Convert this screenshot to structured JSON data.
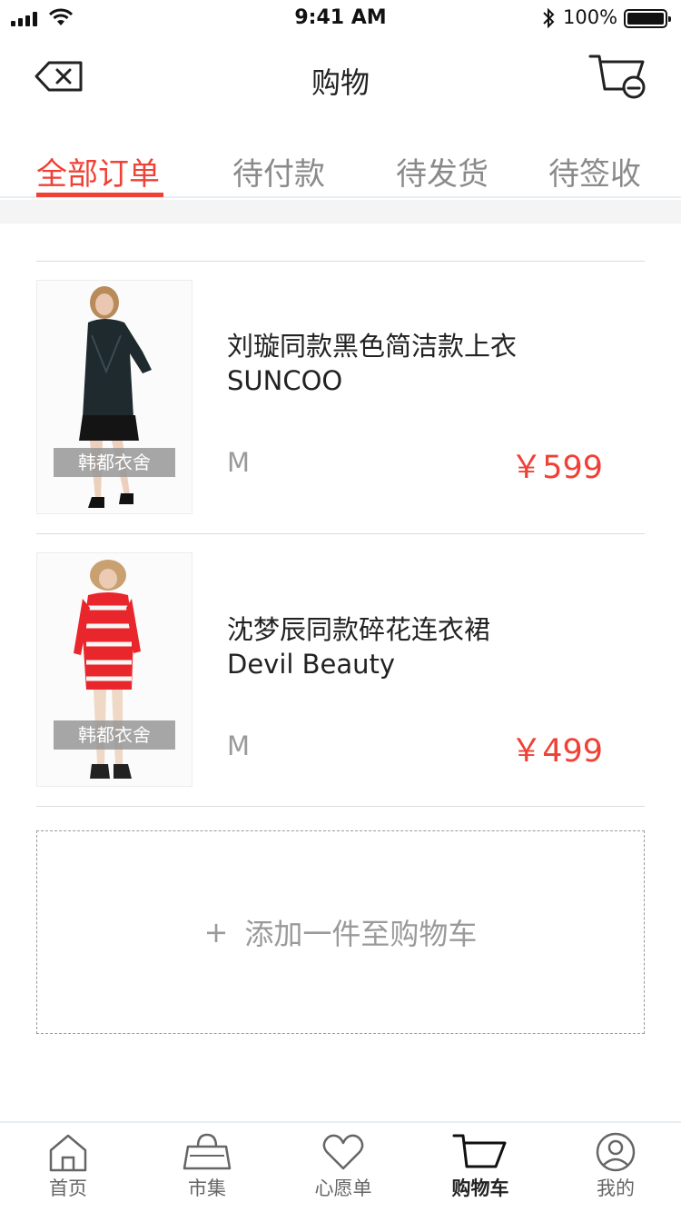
{
  "status_bar": {
    "time": "9:41 AM",
    "battery": "100%"
  },
  "nav": {
    "title": "购物",
    "back_icon": "backspace-icon",
    "cart_icon": "cart-icon"
  },
  "tabs": [
    {
      "label": "全部订单",
      "active": true
    },
    {
      "label": "待付款",
      "active": false
    },
    {
      "label": "待发货",
      "active": false
    },
    {
      "label": "待签收",
      "active": false
    }
  ],
  "items": [
    {
      "name": "刘璇同款黑色简洁款上衣",
      "brand": "SUNCOO",
      "size": "M",
      "price": "￥599",
      "shop": "韩都衣舍"
    },
    {
      "name": "沈梦辰同款碎花连衣裙",
      "brand": "Devil Beauty",
      "size": "M",
      "price": "￥499",
      "shop": "韩都衣舍"
    }
  ],
  "add_to_cart": {
    "plus": "+",
    "label": "添加一件至购物车"
  },
  "tabbar": [
    {
      "label": "首页",
      "icon": "home-icon"
    },
    {
      "label": "市集",
      "icon": "bag-icon"
    },
    {
      "label": "心愿单",
      "icon": "heart-icon"
    },
    {
      "label": "购物车",
      "icon": "cart-icon",
      "active": true
    },
    {
      "label": "我的",
      "icon": "user-icon"
    }
  ],
  "colors": {
    "accent": "#ef4136",
    "muted": "#9a9a9a"
  }
}
